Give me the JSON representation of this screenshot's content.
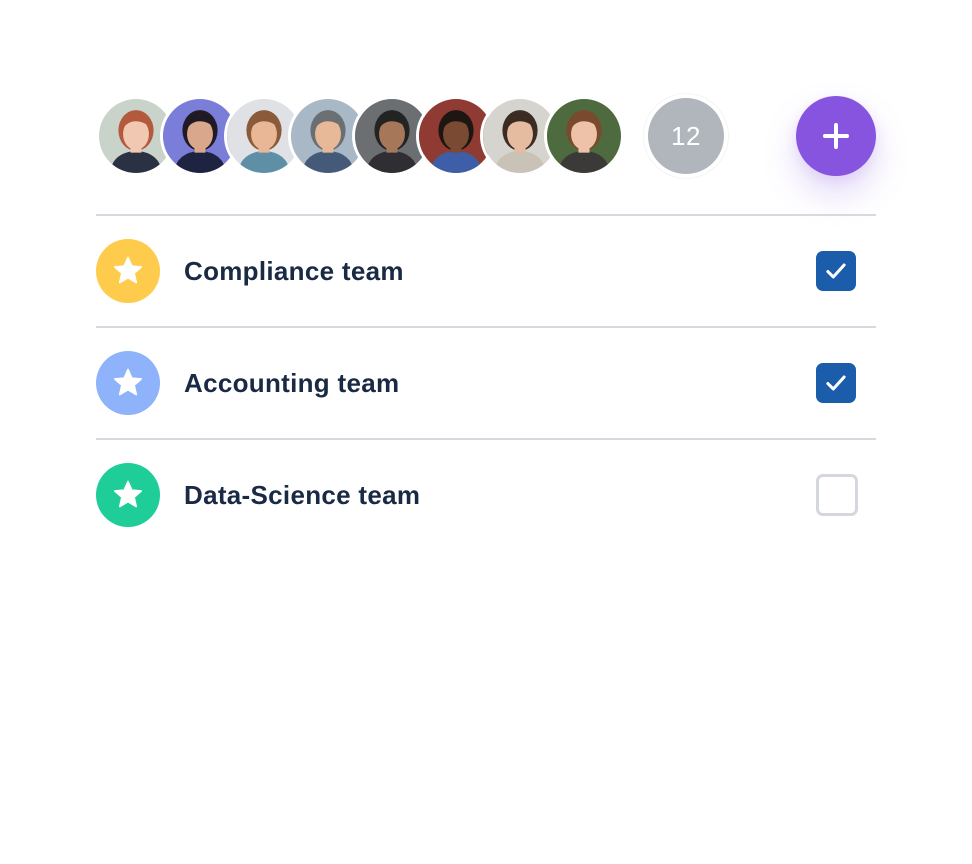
{
  "members": {
    "avatars": [
      {
        "name": "avatar-1",
        "bg": "#c9d3c9",
        "skin": "#f1c8b2",
        "hair": "#b45a3c",
        "shirt": "#2a3142"
      },
      {
        "name": "avatar-2",
        "bg": "#7a7ed8",
        "skin": "#d9a88c",
        "hair": "#1f1a24",
        "shirt": "#1d2340"
      },
      {
        "name": "avatar-3",
        "bg": "#dfe1e4",
        "skin": "#e9b796",
        "hair": "#8a5a3a",
        "shirt": "#5e8fa6"
      },
      {
        "name": "avatar-4",
        "bg": "#a9b8c6",
        "skin": "#e7b999",
        "hair": "#6c6f72",
        "shirt": "#445a78"
      },
      {
        "name": "avatar-5",
        "bg": "#6c6f72",
        "skin": "#a7775a",
        "hair": "#232323",
        "shirt": "#2f2f33"
      },
      {
        "name": "avatar-6",
        "bg": "#8f3b33",
        "skin": "#7a4a32",
        "hair": "#1d1612",
        "shirt": "#3e5fa8"
      },
      {
        "name": "avatar-7",
        "bg": "#d6d4cf",
        "skin": "#e6bca0",
        "hair": "#3a2c22",
        "shirt": "#c9c2b6"
      },
      {
        "name": "avatar-8",
        "bg": "#4d6b3e",
        "skin": "#eec2a8",
        "hair": "#7a4a2e",
        "shirt": "#3c3a38"
      }
    ],
    "more_count": "12"
  },
  "add_button": {
    "icon": "plus-icon",
    "color": "#8654de"
  },
  "teams": [
    {
      "label": "Compliance team",
      "icon": "star-icon",
      "icon_bg": "#fecb4d",
      "checked": true
    },
    {
      "label": "Accounting team",
      "icon": "star-icon",
      "icon_bg": "#8fb3fb",
      "checked": true
    },
    {
      "label": "Data-Science team",
      "icon": "star-icon",
      "icon_bg": "#1ecd97",
      "checked": false
    }
  ],
  "colors": {
    "checkbox_checked": "#1b5cab",
    "checkbox_unchecked_border": "#d4d7dc",
    "divider": "#d5d9e0",
    "text": "#1a2a44"
  }
}
